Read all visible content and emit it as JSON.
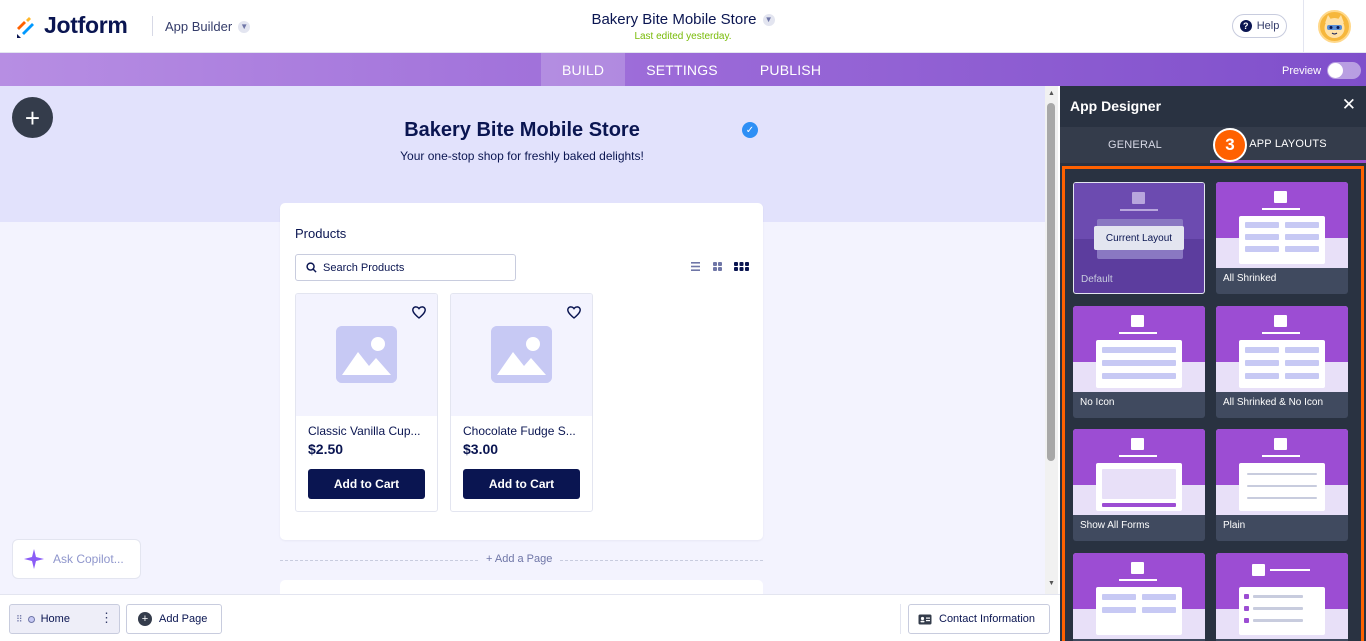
{
  "header": {
    "brand": "Jotform",
    "app_builder": "App Builder",
    "store_title": "Bakery Bite Mobile Store",
    "last_edited": "Last edited yesterday.",
    "help": "Help"
  },
  "nav": {
    "tabs": [
      "BUILD",
      "SETTINGS",
      "PUBLISH"
    ],
    "active_tab": "BUILD",
    "preview": "Preview"
  },
  "hero": {
    "title": "Bakery Bite Mobile Store",
    "subtitle": "Your one-stop shop for freshly baked delights!"
  },
  "products": {
    "label": "Products",
    "search_placeholder": "Search Products",
    "items": [
      {
        "name": "Classic Vanilla Cup...",
        "price": "$2.50",
        "button": "Add to Cart"
      },
      {
        "name": "Chocolate Fudge S...",
        "price": "$3.00",
        "button": "Add to Cart"
      }
    ]
  },
  "add_a_page": "+ Add a Page",
  "copilot": "Ask Copilot...",
  "bottom": {
    "home": "Home",
    "add_page": "Add Page",
    "contact": "Contact Information"
  },
  "panel": {
    "title": "App Designer",
    "tabs": [
      "GENERAL",
      "APP LAYOUTS"
    ],
    "active_tab": "APP LAYOUTS",
    "step_badge": "3",
    "current_layout_label": "Current Layout",
    "layouts": [
      "Default",
      "All Shrinked",
      "No Icon",
      "All Shrinked & No Icon",
      "Show All Forms",
      "Plain",
      "",
      ""
    ]
  },
  "colors": {
    "brand_navy": "#0a1551",
    "accent_purple": "#9c4dd3",
    "highlight_orange": "#ff6100",
    "last_edited_green": "#78bb07"
  }
}
